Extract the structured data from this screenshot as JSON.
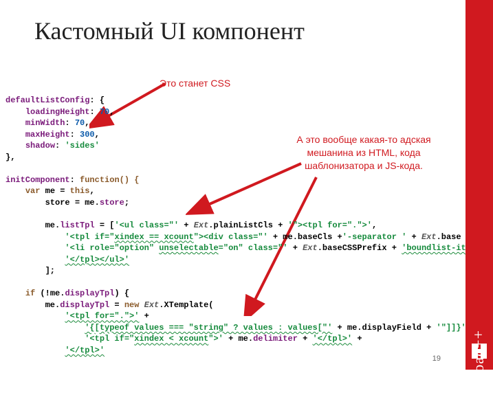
{
  "title": "Кастомный UI компонент",
  "pageNumber": "19",
  "logo": "HighLoad++",
  "annotations": {
    "a1": "Это станет CSS",
    "a2": "А это вообще какая-то адская мешанина из HTML, кода шаблонизатора и JS-кода."
  },
  "code": {
    "defaultListConfig": {
      "label": "defaultListConfig",
      "colon": ": {"
    },
    "loadingHeight": {
      "key": "loadingHeight",
      "val": "70"
    },
    "minWidth": {
      "key": "minWidth",
      "val": "70"
    },
    "maxHeight": {
      "key": "maxHeight",
      "val": "300"
    },
    "shadow": {
      "key": "shadow",
      "val": "'sides'"
    },
    "close1": "},",
    "initComponent": {
      "key": "initComponent",
      "sig": "function() {"
    },
    "varLine": {
      "kw": "var",
      "me": "me = ",
      "this": "this",
      "comma": ","
    },
    "storeLine": {
      "lhs": "store = me.",
      "rhs": "store",
      "semi": ";"
    },
    "listTpl": {
      "lhs": "me.",
      "prop": "listTpl",
      "eq": " = [",
      "s1": "'<ul class=\"'",
      "plus1": " + ",
      "ext": "Ext",
      "plain": ".plainListCls",
      "plus2": " + ",
      "s2": "'\"><tpl for=\".\">'",
      "comma": ","
    },
    "line2": {
      "s1": "'<tpl if=\"",
      "expr": "xindex == xcount",
      "s2": "\"><div class=\"'",
      "plus": " + me.baseCls +",
      "sep": "'-separator '",
      "plus2": " + ",
      "ext": "Ext",
      "tail": ".base"
    },
    "line3": {
      "s1": "'<li role=\"option\" ",
      "un": "unselectable",
      "s2": "=\"on\" class=\"'",
      "plus": " + ",
      "ext": "Ext",
      "pre": ".baseCSSPrefix + ",
      "bound": "'boundlist-it"
    },
    "line4": "'</tpl></ul>'",
    "close2": "];",
    "if": {
      "kw": "if",
      "open": " (!me.",
      "prop": "displayTpl",
      "close": ") {"
    },
    "dtpl": {
      "lhs": "me.",
      "prop": "displayTpl",
      "eq": " = ",
      "kw": "new ",
      "ext": "Ext",
      "xt": ".XTemplate("
    },
    "d1": "'<tpl for=\".\">'",
    "d1b": " +",
    "d2a": "'{[typeof values === \"string\" ? values : values[\"'",
    "d2b": " + me.displayField + ",
    "d2c": "'\"]]}'",
    "d3a": "'<tpl if=\"",
    "d3b": "xindex < xcount",
    "d3c": "\">'",
    "d3d": " + me.",
    "d3e": "delimiter",
    "d3f": " + ",
    "d3g": "'</tpl>'",
    "d3h": " +",
    "d4": "'</tpl>'"
  }
}
